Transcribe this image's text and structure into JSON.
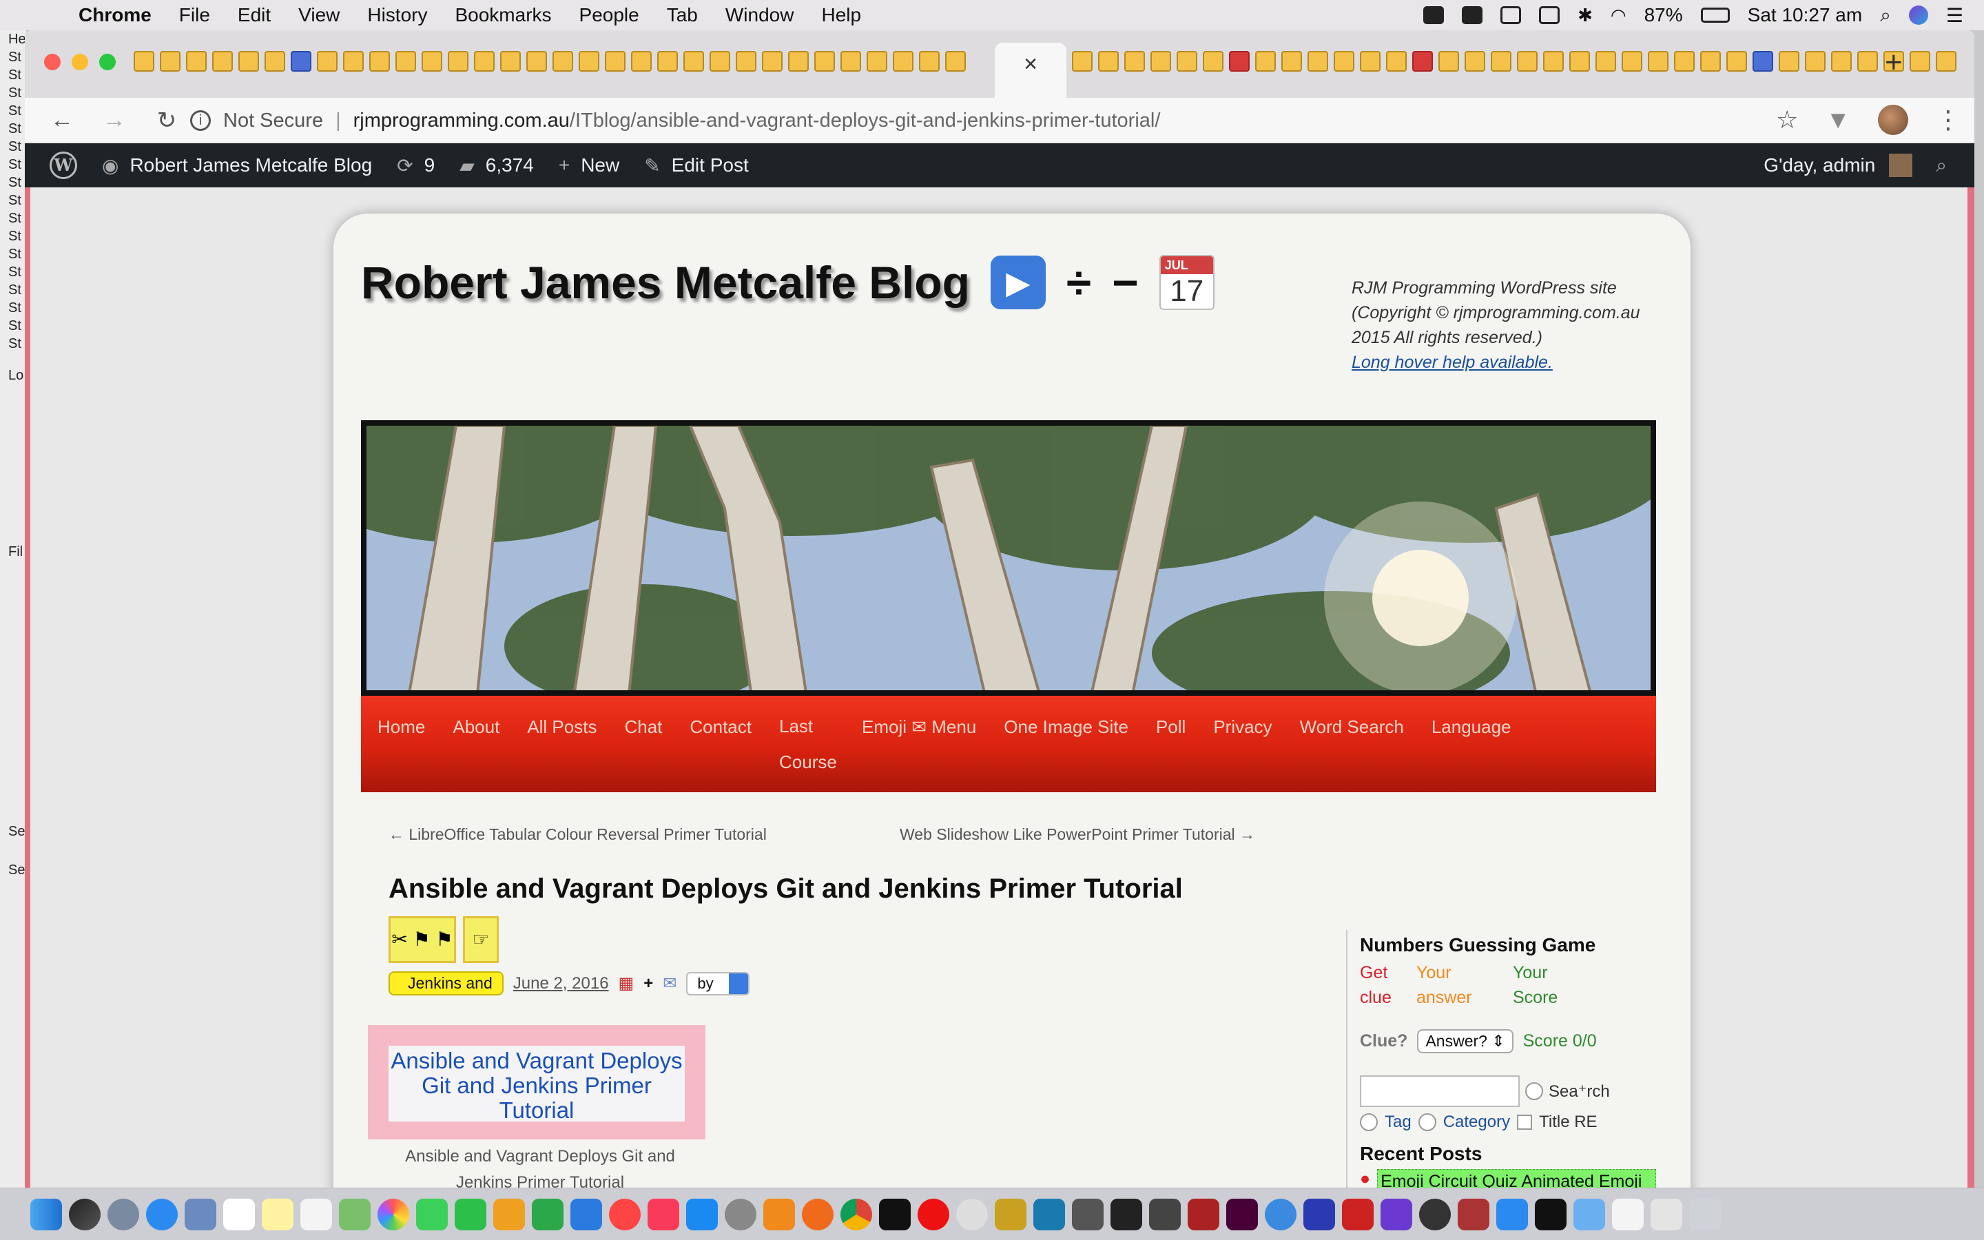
{
  "menubar": {
    "items": [
      "Chrome",
      "File",
      "Edit",
      "View",
      "History",
      "Bookmarks",
      "People",
      "Tab",
      "Window",
      "Help"
    ],
    "battery": "87%",
    "clock": "Sat 10:27 am"
  },
  "left_strip": {
    "lines": [
      "He",
      "St",
      "St",
      "St",
      "St",
      "St",
      "St",
      "St",
      "St",
      "St",
      "St",
      "St",
      "St",
      "St",
      "St",
      "St",
      "St",
      "St",
      "Lo",
      "Fil",
      "Se",
      "Se"
    ]
  },
  "browser": {
    "active_tab_close": "×",
    "new_tab": "+",
    "security_label": "Not Secure",
    "separator": "|",
    "url_host": "rjmprogramming.com.au",
    "url_path": "/ITblog/ansible-and-vagrant-deploys-git-and-jenkins-primer-tutorial/"
  },
  "wp_admin_bar": {
    "site_name": "Robert James Metcalfe Blog",
    "updates_count": "9",
    "comments_count": "6,374",
    "new_label": "New",
    "edit_label": "Edit Post",
    "greeting": "G'day, admin"
  },
  "site": {
    "title": "Robert James Metcalfe Blog",
    "title_emoji_ops": [
      "÷",
      "−"
    ],
    "calendar_month": "JUL",
    "calendar_day": "17",
    "description": "RJM Programming WordPress site (Copyright © rjmprogramming.com.au 2015 All rights reserved.)",
    "hover_help": "Long hover help available."
  },
  "nav": {
    "items": [
      "Home",
      "About",
      "All Posts",
      "Chat",
      "Contact",
      "Last Course",
      "Emoji ✉ Menu",
      "One Image Site",
      "Poll",
      "Privacy",
      "Word Search",
      "Language"
    ]
  },
  "post_nav": {
    "prev": "← LibreOffice Tabular Colour Reversal Primer Tutorial",
    "next": "Web Slideshow Like PowerPoint Primer Tutorial →"
  },
  "post": {
    "title": "Ansible and Vagrant Deploys Git and Jenkins Primer Tutorial",
    "category_select": "Jenkins and",
    "date": "June 2, 2016",
    "by_select": "by",
    "image_alt": "Ansible and Vagrant Deploys Git and Jenkins Primer Tutorial",
    "caption": "Ansible and Vagrant Deploys Git and Jenkins Primer Tutorial"
  },
  "sidebar": {
    "game_title": "Numbers Guessing Game",
    "game_cols": [
      {
        "line1": "Get",
        "line2": "clue",
        "color": "#d8202a"
      },
      {
        "line1": "Your",
        "line2": "answer",
        "color": "#f08a1c"
      },
      {
        "line1": "Your",
        "line2": "Score",
        "color": "#2f8a2f"
      }
    ],
    "clue_label": "Clue?",
    "answer_select": "Answer?",
    "score": "Score 0/0",
    "search_label": "Sea⁺rch",
    "tag_label": "Tag",
    "category_label": "Category",
    "title_re": "Title RE",
    "recent_posts_title": "Recent Posts",
    "recent_post_1": "Emoji Circuit Quiz Animated Emoji Tutorial"
  }
}
